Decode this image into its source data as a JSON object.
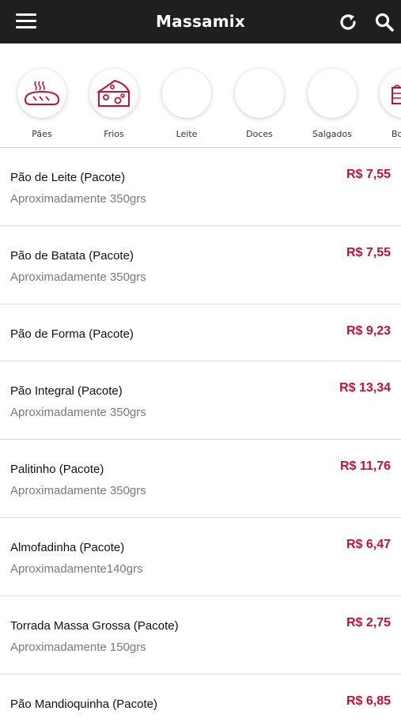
{
  "header": {
    "title": "Massamix"
  },
  "categories": [
    {
      "label": "Pães",
      "icon": "bread-icon"
    },
    {
      "label": "Frios",
      "icon": "cheese-icon"
    },
    {
      "label": "Leite",
      "icon": ""
    },
    {
      "label": "Doces",
      "icon": ""
    },
    {
      "label": "Salgados",
      "icon": ""
    },
    {
      "label": "Bo",
      "icon": "cake-icon"
    }
  ],
  "products": [
    {
      "name": "Pão de Leite (Pacote)",
      "desc": "Aproximadamente 350grs",
      "price": "R$ 7,55"
    },
    {
      "name": "Pão de Batata (Pacote)",
      "desc": "Aproximadamente 350grs",
      "price": "R$ 7,55"
    },
    {
      "name": "Pão de Forma (Pacote)",
      "desc": "",
      "price": "R$ 9,23"
    },
    {
      "name": "Pão Integral (Pacote)",
      "desc": "Aproximadamente 350grs",
      "price": "R$ 13,34"
    },
    {
      "name": "Palitinho (Pacote)",
      "desc": "Aproximadamente 350grs",
      "price": "R$ 11,76"
    },
    {
      "name": "Almofadinha (Pacote)",
      "desc": "Aproximadamente140grs",
      "price": "R$ 6,47"
    },
    {
      "name": "Torrada Massa Grossa (Pacote)",
      "desc": "Aproximadamente 150grs",
      "price": "R$ 2,75"
    },
    {
      "name": "Pão Mandioquinha (Pacote)",
      "desc": "",
      "price": "R$ 6,85"
    }
  ],
  "colors": {
    "accent": "#c8102e",
    "topbar": "#1f1f1f"
  }
}
